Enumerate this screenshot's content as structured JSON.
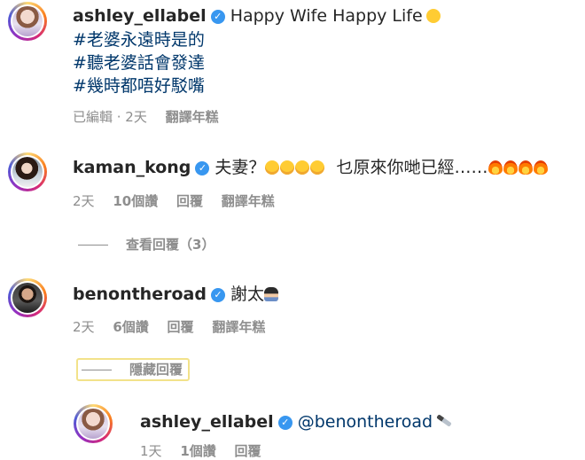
{
  "comments": [
    {
      "username": "ashley_ellabel",
      "text": "Happy Wife Happy Life",
      "hashtags": [
        "#老婆永遠時是的",
        "#聽老婆話會發達",
        "#幾時都唔好駁嘴"
      ],
      "meta": {
        "edited": "已編輯 · 2天",
        "translate": "翻譯年糕"
      }
    },
    {
      "username": "kaman_kong",
      "text_a": "夫妻？",
      "text_b": "乜原來你哋已經……",
      "meta": {
        "time": "2天",
        "likes": "10個讚",
        "reply": "回覆",
        "translate": "翻譯年糕"
      },
      "view_replies": "查看回覆（3）"
    },
    {
      "username": "benontheroad",
      "text": "謝太",
      "meta": {
        "time": "2天",
        "likes": "6個讚",
        "reply": "回覆",
        "translate": "翻譯年糕"
      },
      "hide_replies": "隱藏回覆"
    },
    {
      "username": "ashley_ellabel",
      "mention": "@benontheroad",
      "meta": {
        "time": "1天",
        "likes": "1個讚",
        "reply": "回覆"
      }
    }
  ],
  "verified_glyph": "✓",
  "colors": {
    "text": "#262626",
    "muted": "#8e8e8e",
    "hashtag": "#00376b",
    "verified": "#3897f0",
    "highlight": "#f2e28a"
  },
  "icons": [
    "verified-badge-icon",
    "smile-emoji-icon",
    "wow-emoji-icon",
    "fire-emoji-icon",
    "person-emoji-icon",
    "knife-emoji-icon"
  ]
}
